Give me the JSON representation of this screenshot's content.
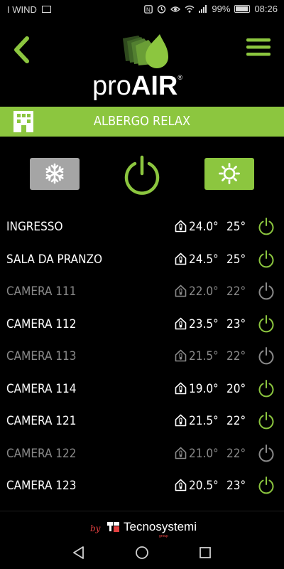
{
  "status_bar": {
    "carrier": "I WIND",
    "battery": "99%",
    "time": "08:26",
    "icons": [
      "mail-icon",
      "nfc-icon",
      "alarm-icon",
      "eye-icon",
      "wifi-icon",
      "signal-icon",
      "battery-icon"
    ]
  },
  "header": {
    "brand_pro": "pro",
    "brand_air": "AIR",
    "brand_reg": "®",
    "back_icon": "chevron-left-icon",
    "menu_icon": "hamburger-menu-icon"
  },
  "building": {
    "name": "ALBERGO RELAX",
    "icon": "building-icon"
  },
  "controls": {
    "cool_icon": "snowflake-icon",
    "power_icon": "power-icon",
    "heat_icon": "sun-icon"
  },
  "rooms": [
    {
      "name": "INGRESSO",
      "temp": "24.0°",
      "setpoint": "25°",
      "active": true
    },
    {
      "name": "SALA DA PRANZO",
      "temp": "24.5°",
      "setpoint": "25°",
      "active": true
    },
    {
      "name": "CAMERA 111",
      "temp": "22.0°",
      "setpoint": "22°",
      "active": false
    },
    {
      "name": "CAMERA 112",
      "temp": "23.5°",
      "setpoint": "23°",
      "active": true
    },
    {
      "name": "CAMERA 113",
      "temp": "21.5°",
      "setpoint": "22°",
      "active": false
    },
    {
      "name": "CAMERA 114",
      "temp": "19.0°",
      "setpoint": "20°",
      "active": true
    },
    {
      "name": "CAMERA 121",
      "temp": "21.5°",
      "setpoint": "22°",
      "active": true
    },
    {
      "name": "CAMERA 122",
      "temp": "21.0°",
      "setpoint": "22°",
      "active": false
    },
    {
      "name": "CAMERA 123",
      "temp": "20.5°",
      "setpoint": "23°",
      "active": true
    }
  ],
  "footer": {
    "by": "by",
    "brand": "Tecnosystemi",
    "sub": "group"
  },
  "colors": {
    "accent": "#8cc63f",
    "inactive": "#8a8a8a",
    "cool_button": "#a5a5a5",
    "background": "#000000"
  }
}
